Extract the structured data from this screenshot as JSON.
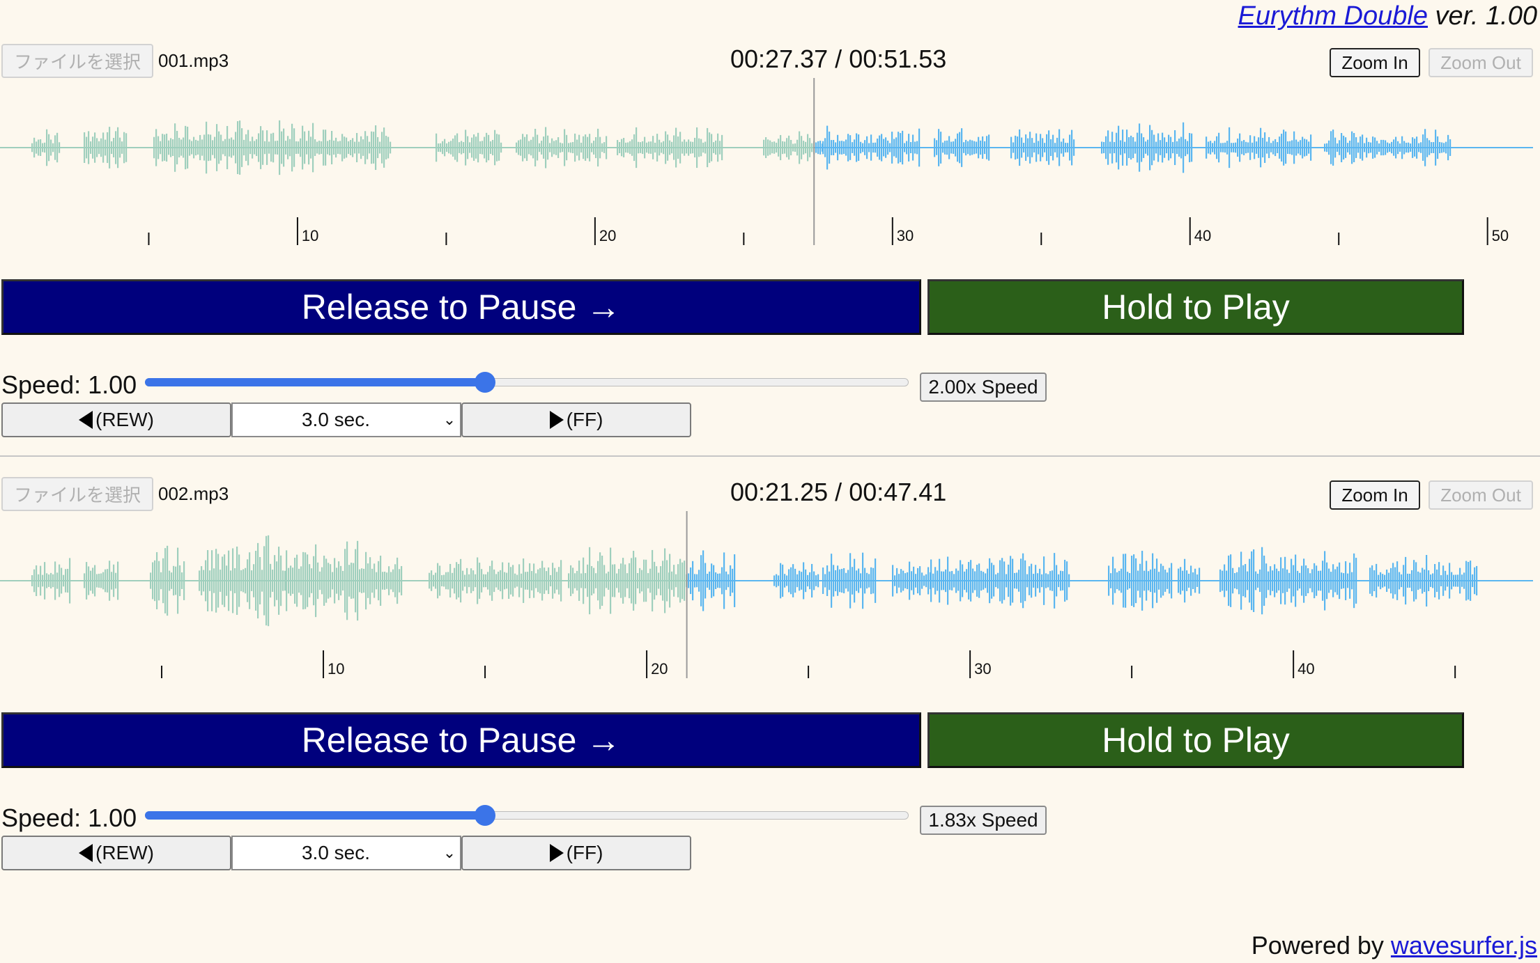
{
  "header": {
    "app_name": "Eurythm Double",
    "version": "ver. 1.00"
  },
  "players": [
    {
      "file_button": "ファイルを選択",
      "file_name": "001.mp3",
      "current_time": "00:27.37",
      "time_separator": "/",
      "duration": "00:51.53",
      "zoom_in": "Zoom In",
      "zoom_out": "Zoom Out",
      "played_fraction": 0.531,
      "axis_seconds": [
        10,
        20,
        30,
        40,
        50
      ],
      "pause_button": "Release to Pause →",
      "play_button": "Hold to Play",
      "speed_label": "Speed: 1.00",
      "speed_slider_fraction": 0.445,
      "speed_button": "2.00x Speed",
      "rew_button": "(REW)",
      "skip_select": "3.0 sec.",
      "ff_button": "(FF)",
      "played_color": "#9fcfbd",
      "unplayed_color": "#5ab6f0"
    },
    {
      "file_button": "ファイルを選択",
      "file_name": "002.mp3",
      "current_time": "00:21.25",
      "time_separator": "/",
      "duration": "00:47.41",
      "zoom_in": "Zoom In",
      "zoom_out": "Zoom Out",
      "played_fraction": 0.448,
      "axis_seconds": [
        10,
        20,
        30,
        40
      ],
      "pause_button": "Release to Pause →",
      "play_button": "Hold to Play",
      "speed_label": "Speed: 1.00",
      "speed_slider_fraction": 0.445,
      "speed_button": "1.83x Speed",
      "rew_button": "(REW)",
      "skip_select": "3.0 sec.",
      "ff_button": "(FF)",
      "played_color": "#9fcfbd",
      "unplayed_color": "#5ab6f0"
    }
  ],
  "footer": {
    "prefix": "Powered by",
    "link": "wavesurfer.js"
  }
}
